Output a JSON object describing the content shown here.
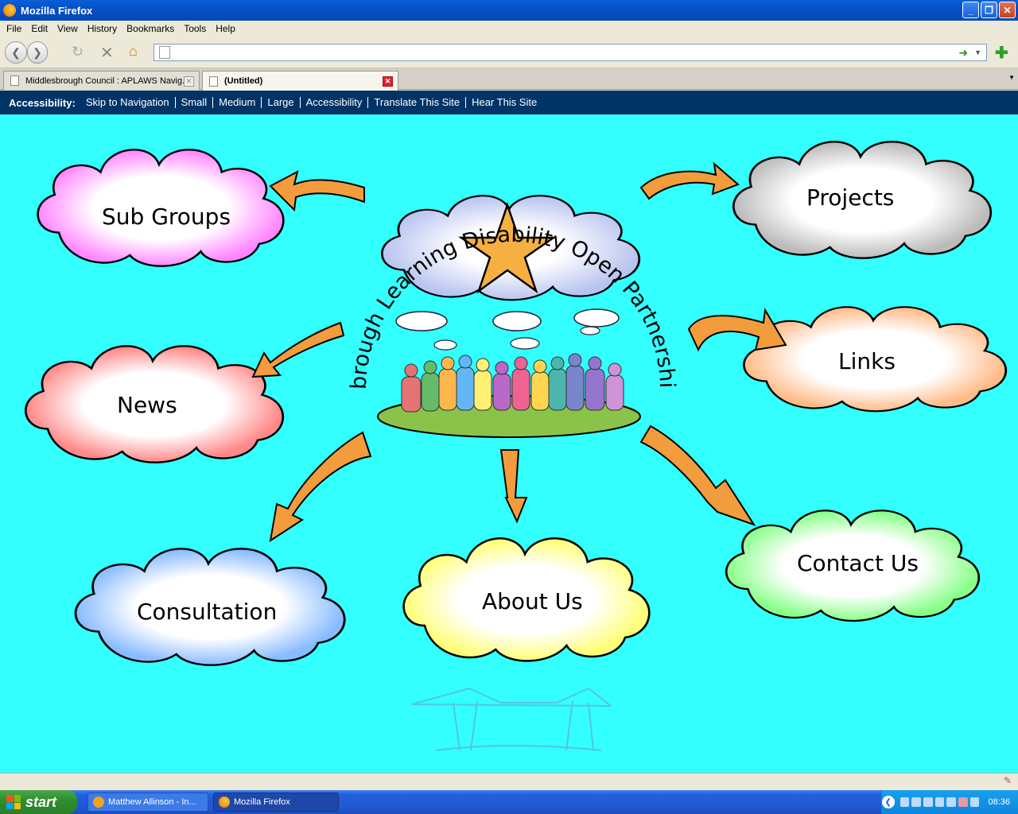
{
  "window": {
    "title": "Mozilla Firefox"
  },
  "menu": [
    "File",
    "Edit",
    "View",
    "History",
    "Bookmarks",
    "Tools",
    "Help"
  ],
  "nav": {
    "url": "",
    "back": "back-icon",
    "forward": "forward-icon",
    "reload": "reload-icon",
    "stop": "stop-icon",
    "home": "home-icon"
  },
  "tabs": [
    {
      "label": "Middlesbrough Council : APLAWS Navig...",
      "active": false
    },
    {
      "label": "(Untitled)",
      "active": true
    }
  ],
  "accessibility": {
    "label": "Accessibility:",
    "links": [
      "Skip to Navigation",
      "Small",
      "Medium",
      "Large",
      "Accessibility",
      "Translate This Site",
      "Hear This Site"
    ]
  },
  "page": {
    "heading_arc": "Middlesbrough Learning Disability Open Partnership Board",
    "clouds": [
      {
        "label": "Sub Groups",
        "color": "#ff99ff"
      },
      {
        "label": "Projects",
        "color": "#c8c8c8"
      },
      {
        "label": "Links",
        "color": "#ffcc99"
      },
      {
        "label": "News",
        "color": "#ff9999"
      },
      {
        "label": "Consultation",
        "color": "#99ccff"
      },
      {
        "label": "About Us",
        "color": "#ffff99"
      },
      {
        "label": "Contact Us",
        "color": "#99ff99"
      }
    ]
  },
  "taskbar": {
    "start": "start",
    "tasks": [
      "Matthew Allinson - In...",
      "Mozilla Firefox"
    ],
    "clock": "08:36"
  }
}
